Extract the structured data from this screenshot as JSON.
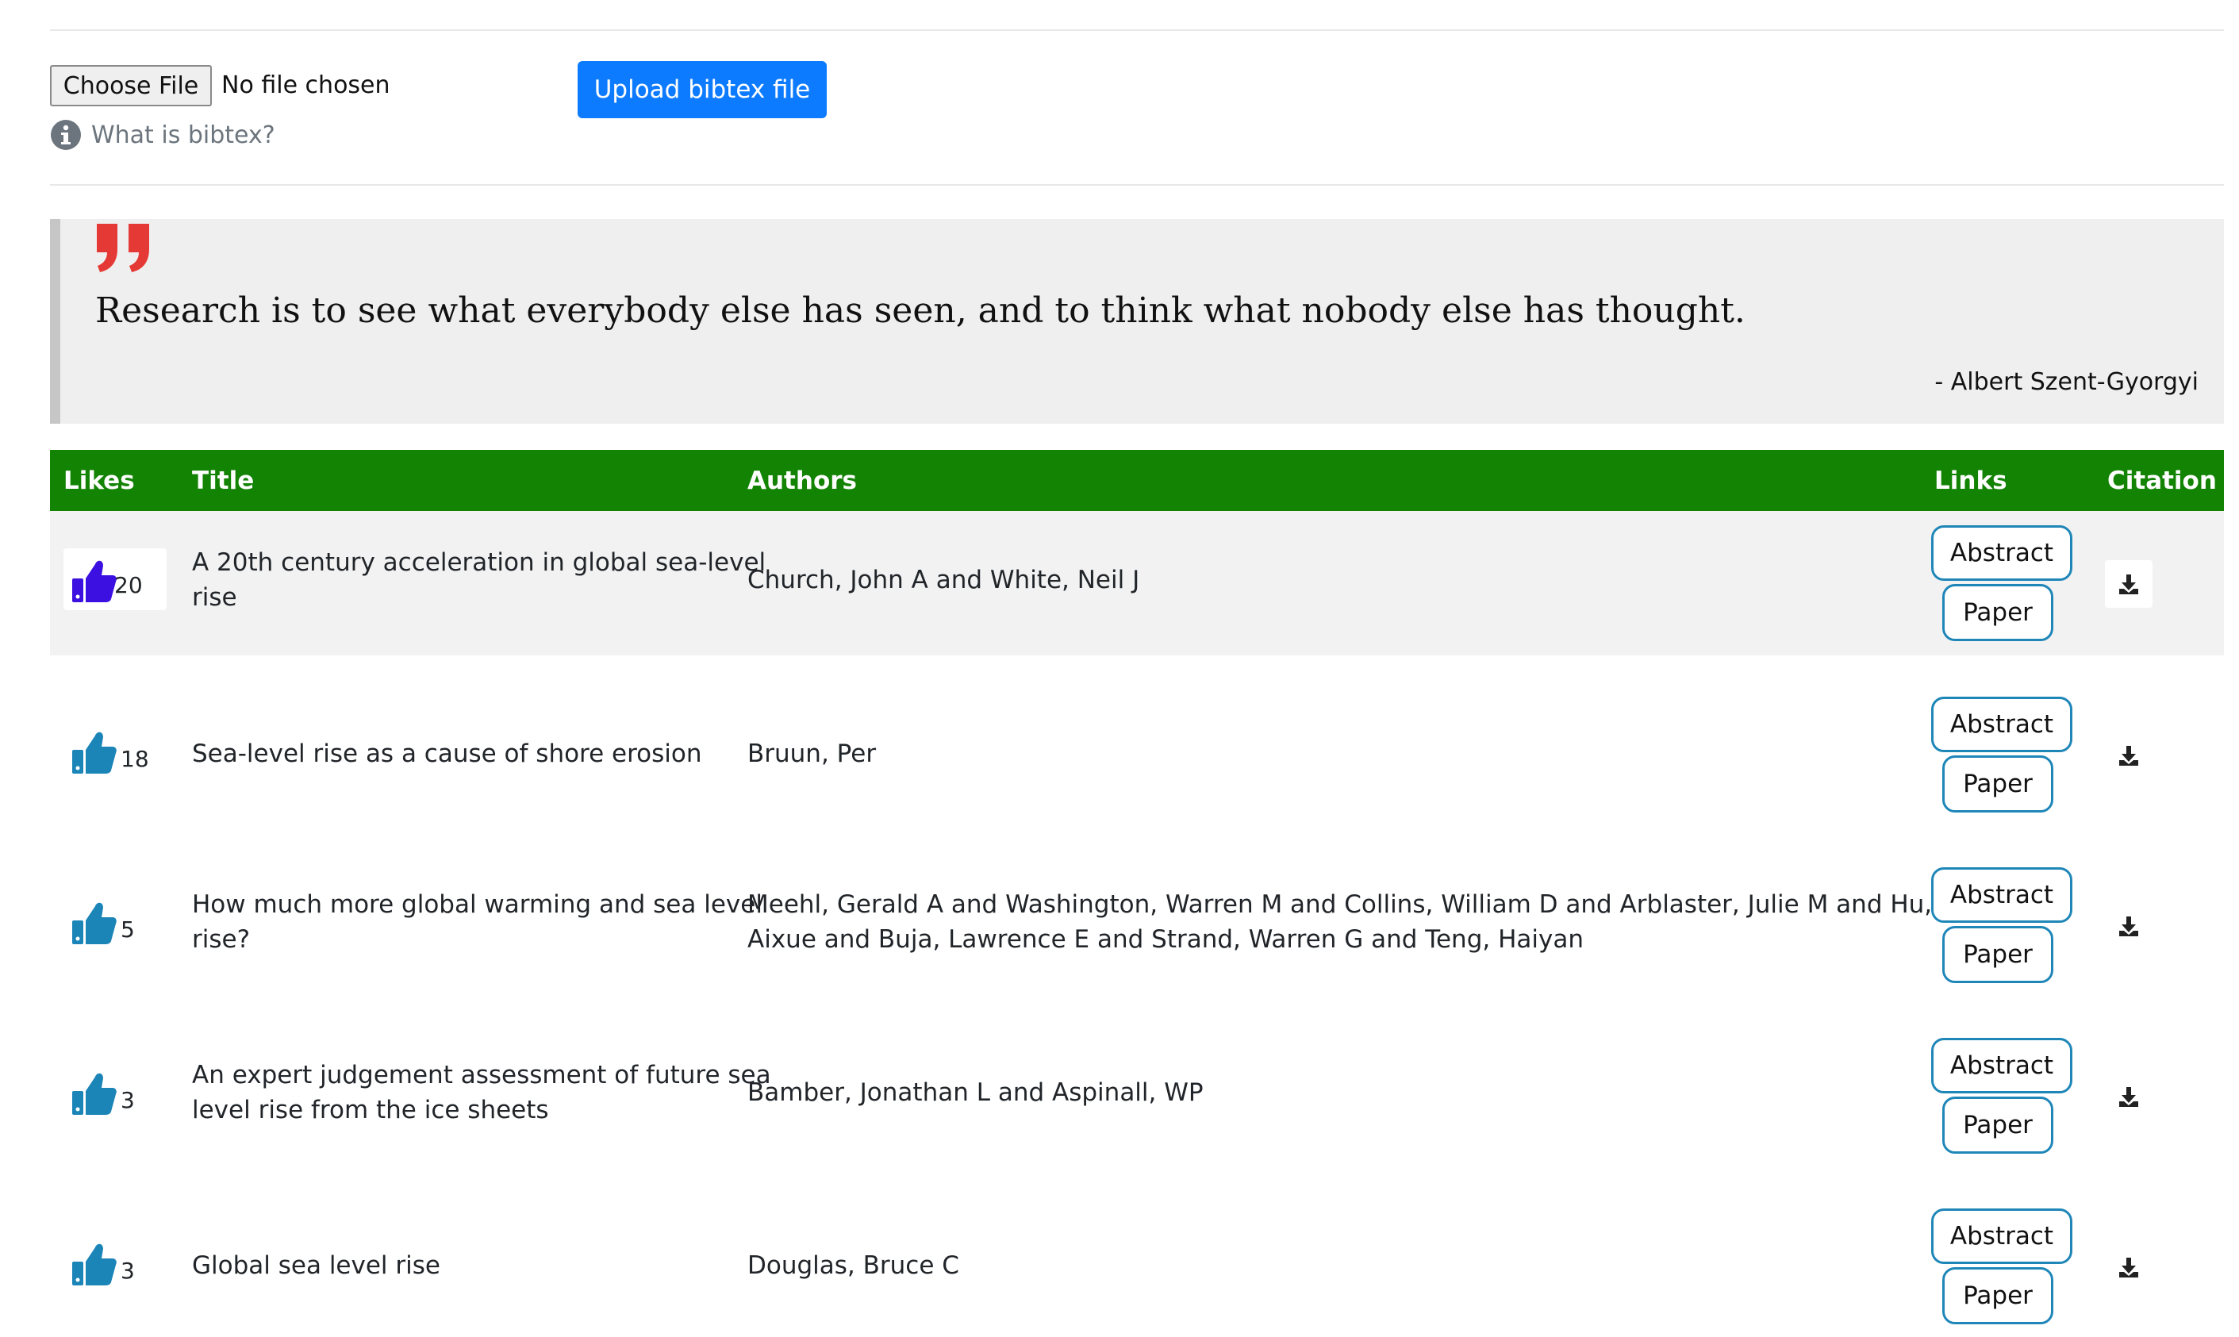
{
  "upload": {
    "choose_file_label": "Choose File",
    "file_status": "No file chosen",
    "upload_button": "Upload bibtex file",
    "info_link": "What is bibtex?"
  },
  "quote": {
    "text": "Research is to see what everybody else has seen, and to think what nobody else has thought.",
    "author": "- Albert Szent-Gyorgyi"
  },
  "table": {
    "headers": {
      "likes": "Likes",
      "title": "Title",
      "authors": "Authors",
      "links": "Links",
      "citation": "Citation"
    },
    "rows": [
      {
        "likes": "20",
        "title": "A 20th century acceleration in global sea-level rise",
        "authors": "Church, John A and White, Neil J",
        "abstract_label": "Abstract",
        "paper_label": "Paper"
      },
      {
        "likes": "18",
        "title": "Sea-level rise as a cause of shore erosion",
        "authors": "Bruun, Per",
        "abstract_label": "Abstract",
        "paper_label": "Paper"
      },
      {
        "likes": "5",
        "title": "How much more global warming and sea level rise?",
        "authors": "Meehl, Gerald A and Washington, Warren M and Collins, William D and Arblaster, Julie M and Hu, Aixue and Buja, Lawrence E and Strand, Warren G and Teng, Haiyan",
        "abstract_label": "Abstract",
        "paper_label": "Paper"
      },
      {
        "likes": "3",
        "title": "An expert judgement assessment of future sea level rise from the ice sheets",
        "authors": "Bamber, Jonathan L and Aspinall, WP",
        "abstract_label": "Abstract",
        "paper_label": "Paper"
      },
      {
        "likes": "3",
        "title": "Global sea level rise",
        "authors": "Douglas, Bruce C",
        "abstract_label": "Abstract",
        "paper_label": "Paper"
      }
    ]
  },
  "colors": {
    "header_green": "#138304",
    "upload_blue": "#0d7bff",
    "quote_red": "#e53935",
    "liked_thumb": "#3b10e0",
    "thumb": "#1b85b8",
    "link_border": "#1f86b8"
  },
  "icons": {
    "info": "info-circle-icon",
    "quote": "quote-icon",
    "like": "thumbs-up-icon",
    "download": "download-icon"
  }
}
